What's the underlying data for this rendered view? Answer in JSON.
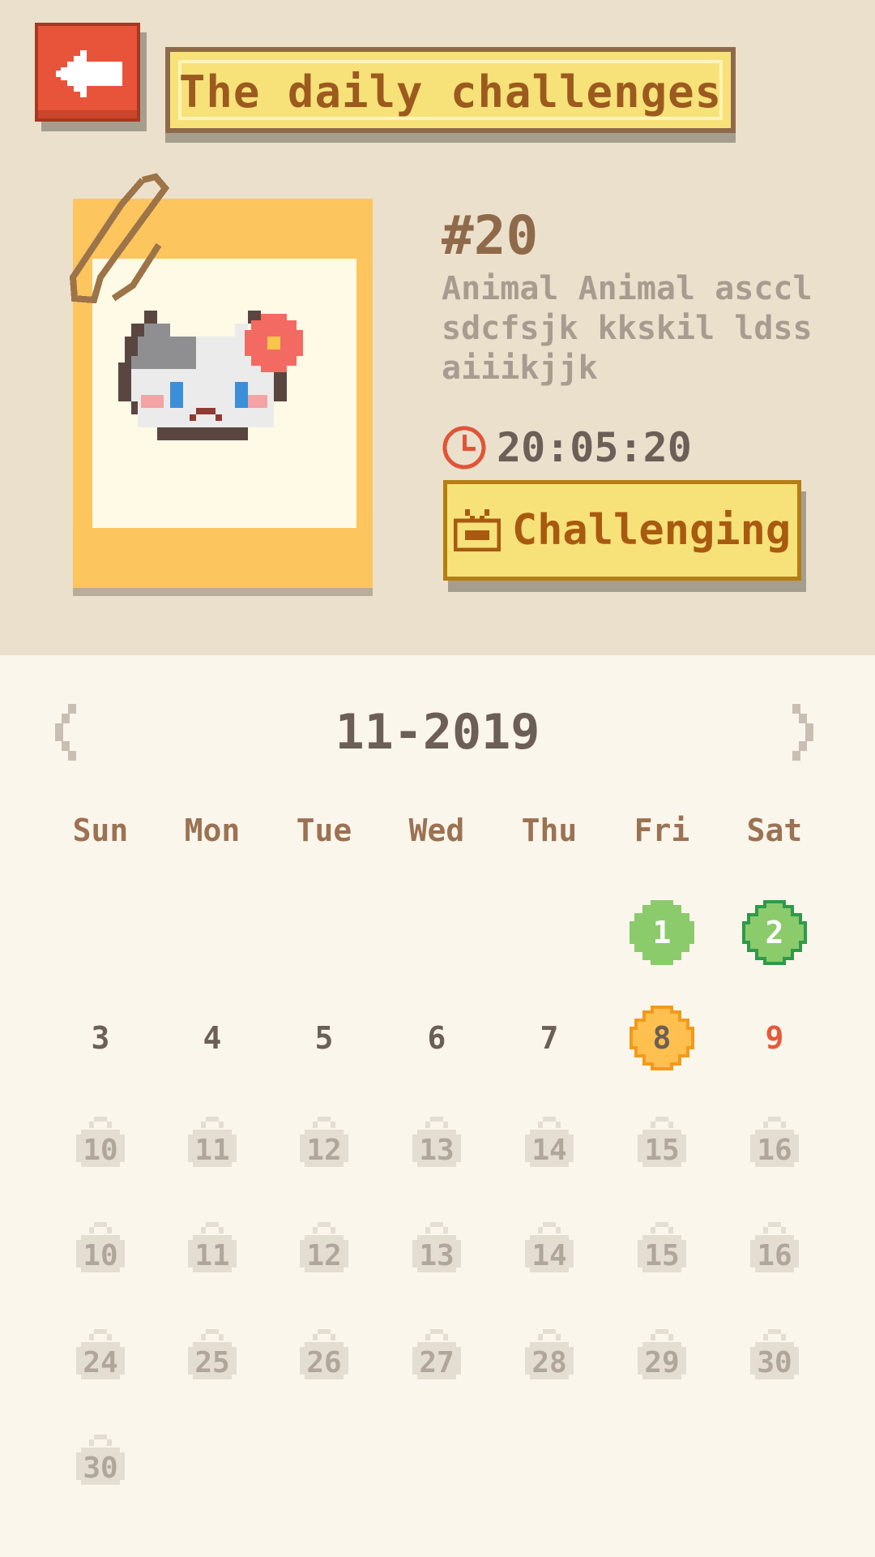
{
  "header": {
    "back_icon": "arrow-left-icon",
    "title": "The daily challenges"
  },
  "challenge": {
    "number": "#20",
    "description": "Animal Animal asccl sdcfsjk kkskil ldss aiiikjjk",
    "timer": "20:05:20",
    "button_label": "Challenging",
    "button_icon": "tv-icon",
    "timer_icon": "clock-icon"
  },
  "calendar": {
    "month_label": "11-2019",
    "prev_icon": "chevron-left-icon",
    "next_icon": "chevron-right-icon",
    "weekdays": [
      "Sun",
      "Mon",
      "Tue",
      "Wed",
      "Thu",
      "Fri",
      "Sat"
    ],
    "rows": [
      [
        null,
        null,
        null,
        null,
        null,
        {
          "d": "1",
          "s": "done-light"
        },
        {
          "d": "2",
          "s": "done"
        }
      ],
      [
        {
          "d": "3",
          "s": "normal"
        },
        {
          "d": "4",
          "s": "normal"
        },
        {
          "d": "5",
          "s": "normal"
        },
        {
          "d": "6",
          "s": "normal"
        },
        {
          "d": "7",
          "s": "normal"
        },
        {
          "d": "8",
          "s": "today"
        },
        {
          "d": "9",
          "s": "sat"
        }
      ],
      [
        {
          "d": "10",
          "s": "locked"
        },
        {
          "d": "11",
          "s": "locked"
        },
        {
          "d": "12",
          "s": "locked"
        },
        {
          "d": "13",
          "s": "locked"
        },
        {
          "d": "14",
          "s": "locked"
        },
        {
          "d": "15",
          "s": "locked"
        },
        {
          "d": "16",
          "s": "locked"
        }
      ],
      [
        {
          "d": "10",
          "s": "locked"
        },
        {
          "d": "11",
          "s": "locked"
        },
        {
          "d": "12",
          "s": "locked"
        },
        {
          "d": "13",
          "s": "locked"
        },
        {
          "d": "14",
          "s": "locked"
        },
        {
          "d": "15",
          "s": "locked"
        },
        {
          "d": "16",
          "s": "locked"
        }
      ],
      [
        {
          "d": "24",
          "s": "locked"
        },
        {
          "d": "25",
          "s": "locked"
        },
        {
          "d": "26",
          "s": "locked"
        },
        {
          "d": "27",
          "s": "locked"
        },
        {
          "d": "28",
          "s": "locked"
        },
        {
          "d": "29",
          "s": "locked"
        },
        {
          "d": "30",
          "s": "locked"
        }
      ],
      [
        {
          "d": "30",
          "s": "locked"
        },
        null,
        null,
        null,
        null,
        null,
        null
      ]
    ]
  },
  "colors": {
    "accent_red": "#e8543a",
    "banner_yellow": "#f7e27a",
    "done_green": "#8bcb6b",
    "done_green_dark": "#62b55a",
    "today_orange": "#ffc04f"
  }
}
